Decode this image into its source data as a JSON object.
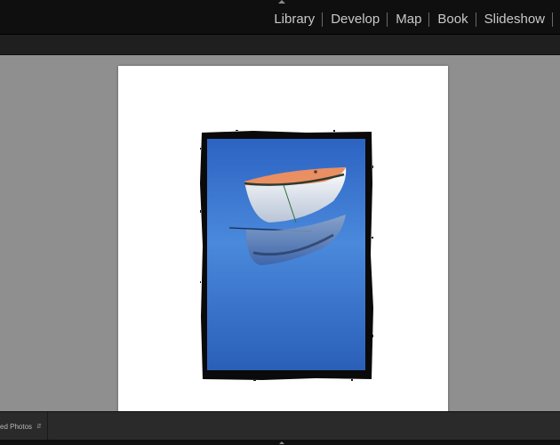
{
  "modules": [
    {
      "label": "Library"
    },
    {
      "label": "Develop"
    },
    {
      "label": "Map"
    },
    {
      "label": "Book"
    },
    {
      "label": "Slideshow"
    }
  ],
  "bottom": {
    "source_label": "ed Photos"
  },
  "colors": {
    "topbar": "#0f0f0f",
    "canvas": "#8f8f8f",
    "page": "#ffffff",
    "photo_sky": "#3f7fd6",
    "boat_top": "#e8956a"
  },
  "icons": {
    "top_panel_toggle": "triangle-up-icon",
    "bottom_panel_toggle": "triangle-up-icon",
    "source_chevron": "up-down-chevron-icon"
  }
}
